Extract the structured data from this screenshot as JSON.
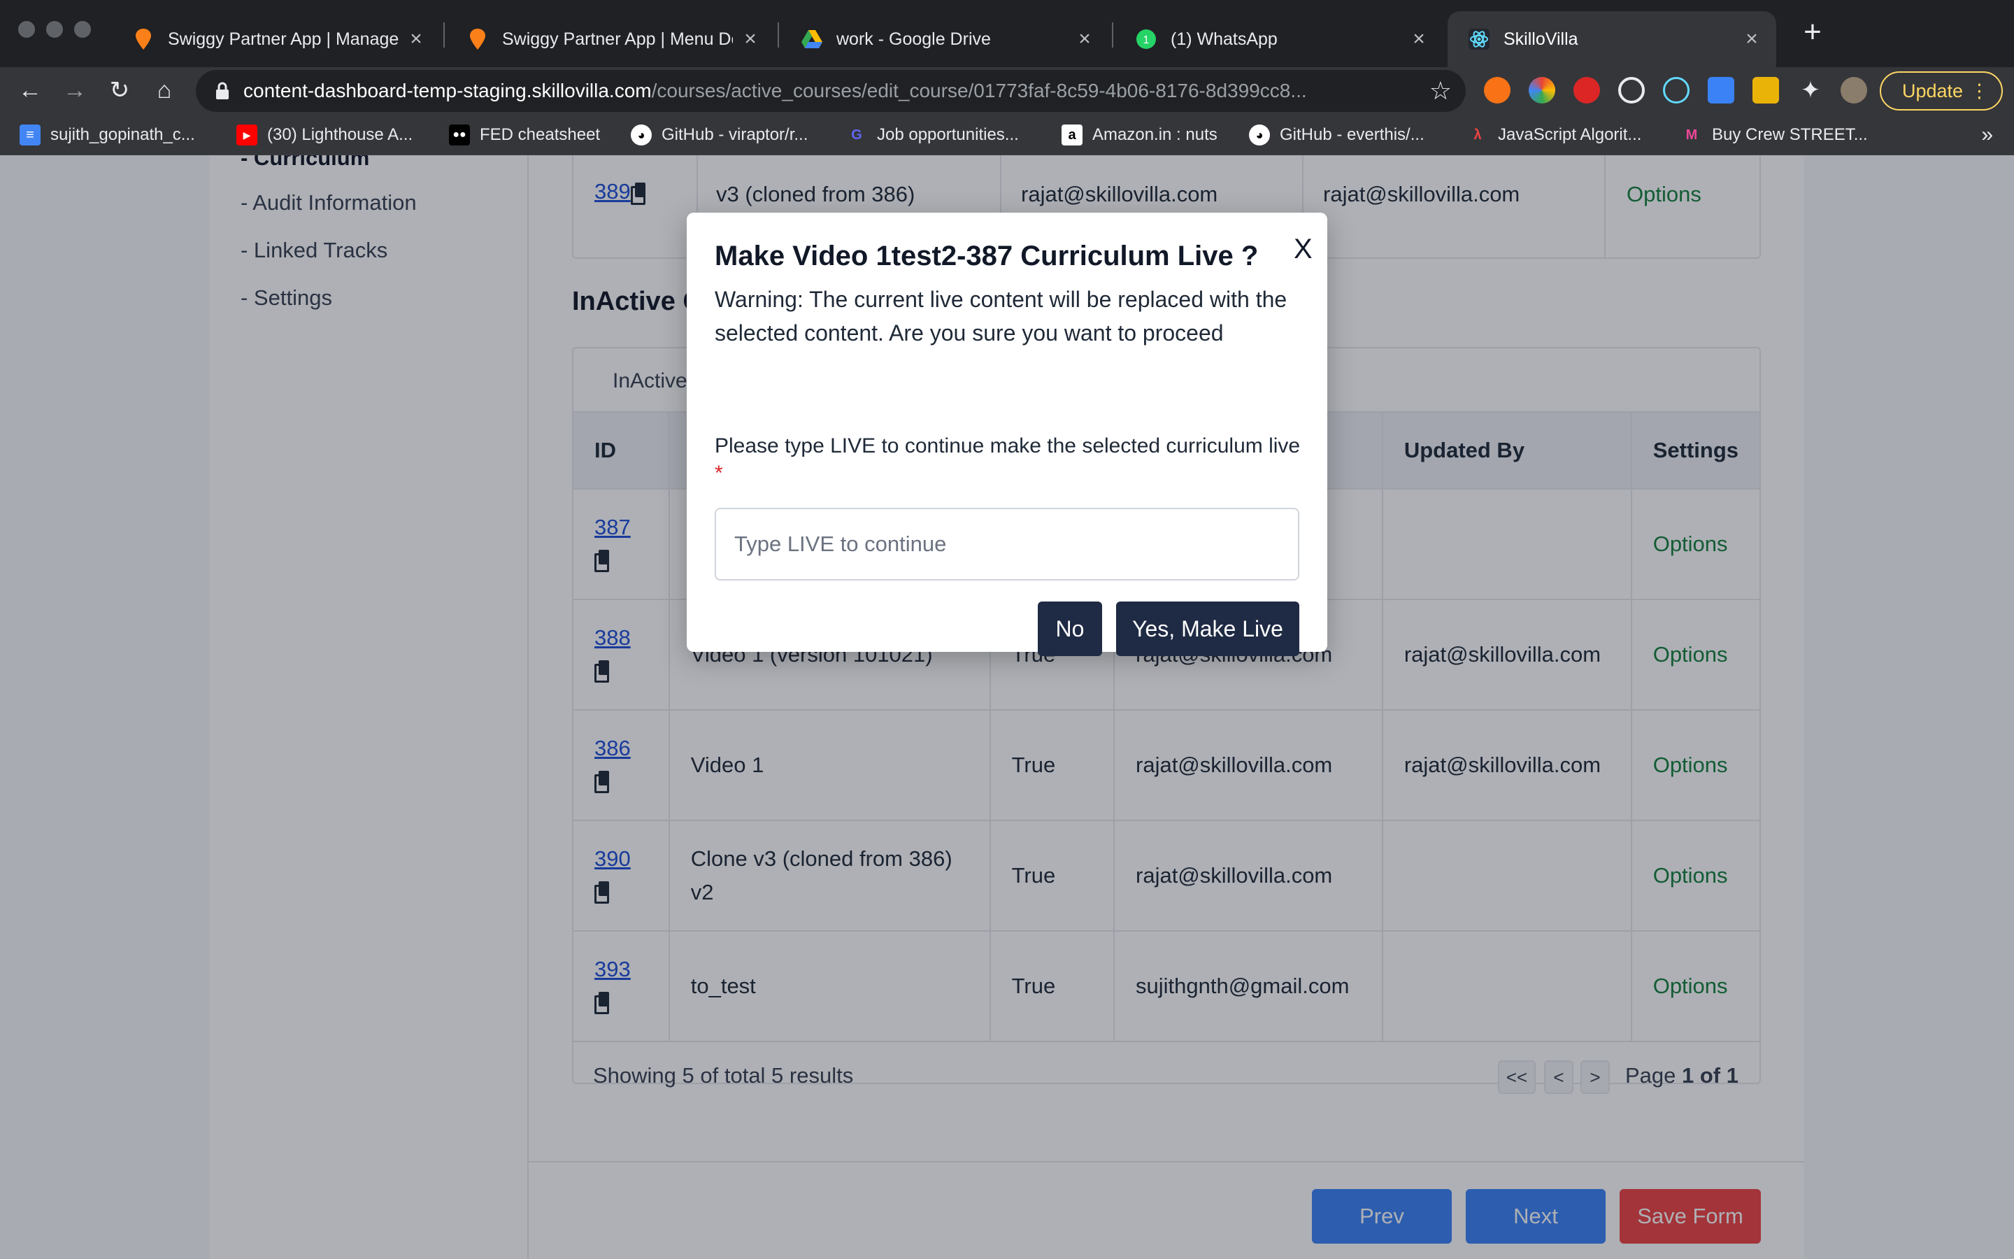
{
  "browser": {
    "tabs": [
      {
        "title": "Swiggy Partner App | Manage C",
        "active": false
      },
      {
        "title": "Swiggy Partner App | Menu De",
        "active": false
      },
      {
        "title": "work - Google Drive",
        "active": false
      },
      {
        "title": "(1) WhatsApp",
        "active": false
      },
      {
        "title": "SkilloVilla",
        "active": true
      }
    ],
    "url_host": "content-dashboard-temp-staging.skillovilla.com",
    "url_path": "/courses/active_courses/edit_course/01773faf-8c59-4b06-8176-8d399cc8...",
    "update_label": "Update",
    "bookmarks": [
      {
        "label": "sujith_gopinath_c...",
        "icon": "docs-icon"
      },
      {
        "label": "(30) Lighthouse A...",
        "icon": "youtube-icon"
      },
      {
        "label": "FED cheatsheet",
        "icon": "medium-icon"
      },
      {
        "label": "GitHub - viraptor/r...",
        "icon": "github-icon"
      },
      {
        "label": "Job opportunities...",
        "icon": "job-icon"
      },
      {
        "label": "Amazon.in : nuts",
        "icon": "amazon-icon"
      },
      {
        "label": "GitHub - everthis/...",
        "icon": "github-icon"
      },
      {
        "label": "JavaScript Algorit...",
        "icon": "js-icon"
      },
      {
        "label": "Buy Crew STREET...",
        "icon": "myntra-icon"
      }
    ],
    "bookmarks_more": "»"
  },
  "sidebar": {
    "items": [
      {
        "label": "- Curriculum",
        "current": true
      },
      {
        "label": "- Audit Information"
      },
      {
        "label": "- Linked Tracks"
      },
      {
        "label": "- Settings"
      }
    ]
  },
  "active_row": {
    "id": "389",
    "name": "v3 (cloned from 386)",
    "created_by": "rajat@skillovilla.com",
    "updated_by": "rajat@skillovilla.com",
    "options": "Options"
  },
  "inactive": {
    "section_title": "InActive C",
    "subtab": "InActive",
    "headers": {
      "id": "ID",
      "name": "",
      "live": "",
      "created_by": "m",
      "updated_by": "Updated By",
      "settings": "Settings"
    },
    "rows": [
      {
        "id": "387",
        "name": "",
        "live": "",
        "created_by": "m",
        "updated_by": "",
        "options": "Options"
      },
      {
        "id": "388",
        "name": "Video 1 (version 101021)",
        "live": "True",
        "created_by": "rajat@skillovilla.com",
        "updated_by": "rajat@skillovilla.com",
        "options": "Options"
      },
      {
        "id": "386",
        "name": "Video 1",
        "live": "True",
        "created_by": "rajat@skillovilla.com",
        "updated_by": "rajat@skillovilla.com",
        "options": "Options"
      },
      {
        "id": "390",
        "name": "Clone v3 (cloned from 386) v2",
        "live": "True",
        "created_by": "rajat@skillovilla.com",
        "updated_by": "",
        "options": "Options"
      },
      {
        "id": "393",
        "name": "to_test",
        "live": "True",
        "created_by": "sujithgnth@gmail.com",
        "updated_by": "",
        "options": "Options"
      }
    ],
    "showing": "Showing 5 of total 5 results",
    "pagination": {
      "first": "<<",
      "prev": "<",
      "next": ">",
      "page_prefix": "Page ",
      "page_value": "1 of 1"
    }
  },
  "form_footer": {
    "prev": "Prev",
    "next": "Next",
    "save": "Save Form"
  },
  "modal": {
    "title": "Make Video 1test2-387 Curriculum Live ?",
    "close": "X",
    "warning": "Warning: The current live content will be replaced with the selected content. Are you sure you want to proceed",
    "label": "Please type LIVE to continue make the selected curriculum live",
    "required_mark": "*",
    "input_placeholder": "Type LIVE to continue",
    "input_value": "",
    "no_label": "No",
    "yes_label": "Yes, Make Live"
  },
  "colors": {
    "primary_dark": "#1f2a44",
    "link": "#1d4ed8",
    "options": "#15803d",
    "update_accent": "#fdd663"
  }
}
